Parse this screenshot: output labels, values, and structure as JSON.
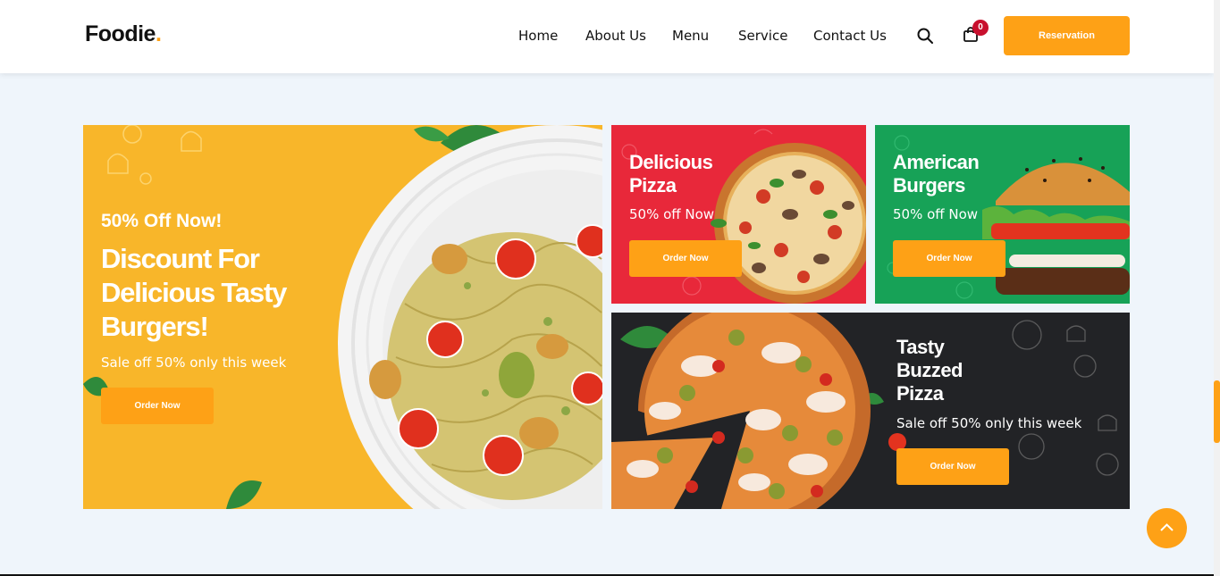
{
  "header": {
    "logo_text": "Foodie",
    "logo_dot": ".",
    "nav": [
      "Home",
      "About Us",
      "Menu",
      "Service",
      "Contact Us"
    ],
    "cart_count": "0",
    "reservation_label": "Reservation"
  },
  "icons": {
    "search": "search-icon",
    "cart": "shopping-bag-icon",
    "back_to_top": "arrow-up-icon"
  },
  "colors": {
    "accent": "#fea116",
    "red_card": "#e8283a",
    "green_card": "#17a257",
    "dark_card": "#222326",
    "yellow_card": "#f8b62a"
  },
  "cards": {
    "main": {
      "eyebrow": "50% Off Now!",
      "title_line1": "Discount For",
      "title_line2": "Delicious Tasty",
      "title_line3": "Burgers!",
      "subtitle": "Sale off 50% only this week",
      "button": "Order Now"
    },
    "pizza": {
      "title_line1": "Delicious",
      "title_line2": "Pizza",
      "subtitle": "50% off Now",
      "button": "Order Now"
    },
    "burger": {
      "title_line1": "American",
      "title_line2": "Burgers",
      "subtitle": "50% off Now",
      "button": "Order Now"
    },
    "buzzed": {
      "title_line1": "Tasty",
      "title_line2": "Buzzed",
      "title_line3": "Pizza",
      "subtitle": "Sale off 50% only this week",
      "button": "Order Now"
    }
  }
}
